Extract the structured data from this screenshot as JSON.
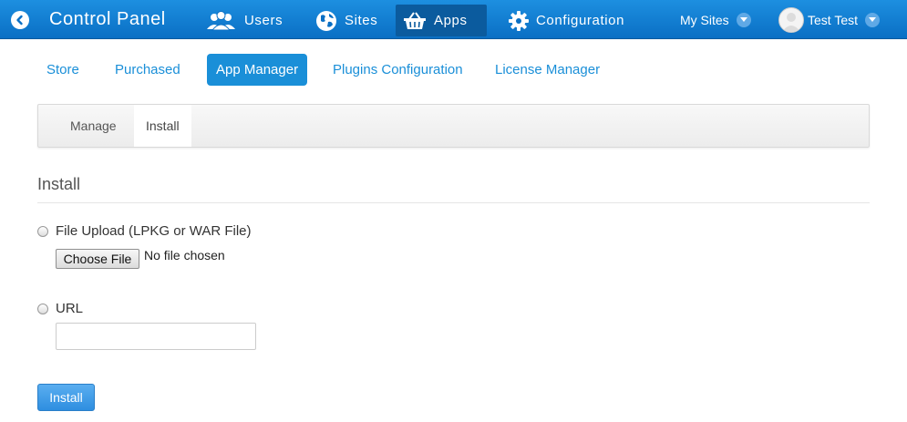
{
  "app": {
    "brand": "Control Panel",
    "nav": {
      "users": "Users",
      "sites": "Sites",
      "apps": "Apps",
      "configuration": "Configuration"
    },
    "my_sites": "My Sites",
    "user_name": "Test Test"
  },
  "subnav": {
    "store": "Store",
    "purchased": "Purchased",
    "app_manager": "App Manager",
    "plugins_configuration": "Plugins Configuration",
    "license_manager": "License Manager"
  },
  "tabs": {
    "manage": "Manage",
    "install": "Install"
  },
  "form": {
    "title": "Install",
    "file_upload_label": "File Upload (LPKG or WAR File)",
    "choose_file": "Choose File",
    "no_file": "No file chosen",
    "url_label": "URL",
    "url_value": "",
    "install_button": "Install"
  },
  "colors": {
    "header": "#0a6fc4",
    "accent": "#1a8fd8",
    "active_nav": "#0b5b9e"
  }
}
